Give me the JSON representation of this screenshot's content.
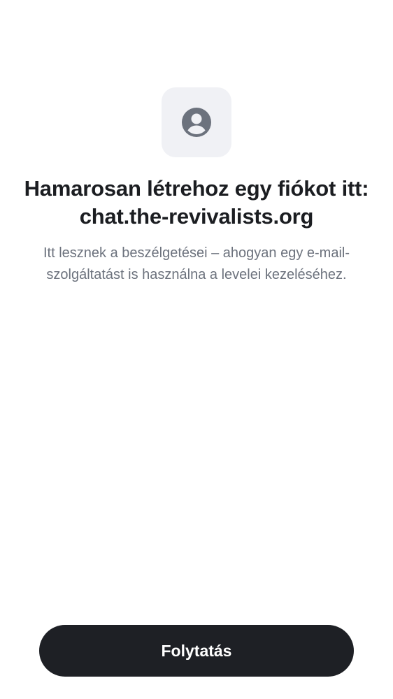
{
  "header": {
    "icon": "user-account-icon",
    "title": "Hamarosan létrehoz egy fiókot itt: chat.the-revivalists.org",
    "subtitle": "Itt lesznek a beszélgetései – ahogyan egy e-mail-szolgáltatást is használna a levelei kezeléséhez."
  },
  "actions": {
    "continue_label": "Folytatás"
  },
  "colors": {
    "background": "#ffffff",
    "icon_tile": "#f0f1f5",
    "icon": "#6c727d",
    "title": "#1b1d21",
    "subtitle": "#6c727d",
    "button_bg": "#1e2025",
    "button_text": "#ffffff"
  }
}
